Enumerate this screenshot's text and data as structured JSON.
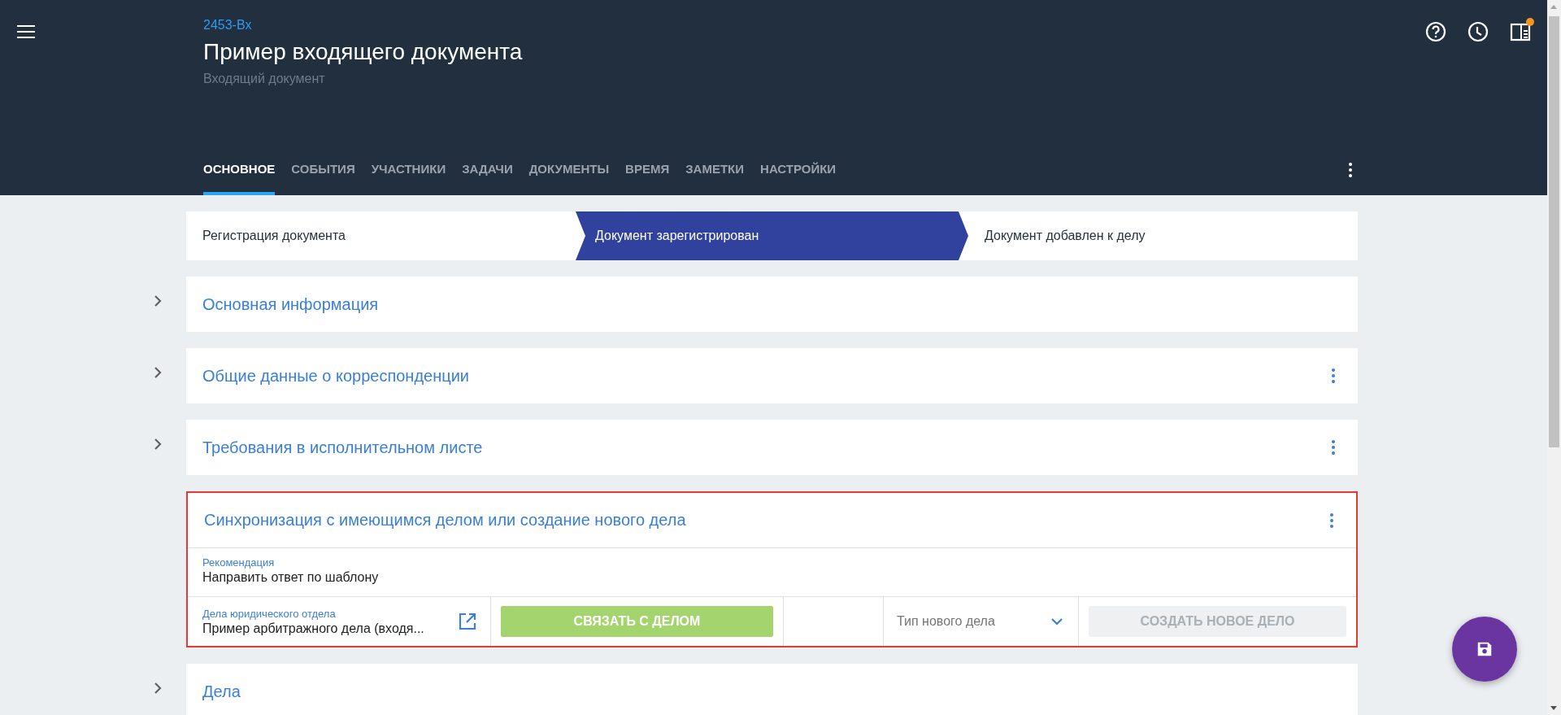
{
  "header": {
    "number": "2453-Вх",
    "title": "Пример входящего документа",
    "subtitle": "Входящий документ",
    "notification": true
  },
  "tabs": [
    {
      "label": "ОСНОВНОЕ",
      "selected": true
    },
    {
      "label": "СОБЫТИЯ",
      "selected": false
    },
    {
      "label": "УЧАСТНИКИ",
      "selected": false
    },
    {
      "label": "ЗАДАЧИ",
      "selected": false
    },
    {
      "label": "ДОКУМЕНТЫ",
      "selected": false
    },
    {
      "label": "ВРЕМЯ",
      "selected": false
    },
    {
      "label": "ЗАМЕТКИ",
      "selected": false
    },
    {
      "label": "НАСТРОЙКИ",
      "selected": false
    }
  ],
  "steps": [
    {
      "label": "Регистрация документа",
      "selected": false
    },
    {
      "label": "Документ зарегистрирован",
      "selected": true
    },
    {
      "label": "Документ добавлен к делу",
      "selected": false
    }
  ],
  "sections": [
    {
      "title": "Основная информация",
      "expanded": false,
      "menu": false,
      "highlighted": false
    },
    {
      "title": "Общие данные о корреспонденции",
      "expanded": false,
      "menu": true,
      "highlighted": false
    },
    {
      "title": "Требования в исполнительном листе",
      "expanded": false,
      "menu": true,
      "highlighted": false
    },
    {
      "title": "Синхронизация с имеющимся делом или создание нового дела",
      "expanded": true,
      "menu": true,
      "highlighted": true,
      "recommendation": {
        "label": "Рекомендация",
        "value": "Направить ответ по шаблону"
      },
      "case": {
        "label": "Дела юридического отдела",
        "value": "Пример арбитражного дела (входя..."
      },
      "link_button": {
        "label": "СВЯЗАТЬ С ДЕЛОМ",
        "disabled": false
      },
      "type_select": {
        "placeholder": "Тип нового дела"
      },
      "create_button": {
        "label": "СОЗДАТЬ НОВОЕ ДЕЛО",
        "disabled": true
      }
    },
    {
      "title": "Дела",
      "expanded": false,
      "menu": false,
      "highlighted": false
    }
  ]
}
